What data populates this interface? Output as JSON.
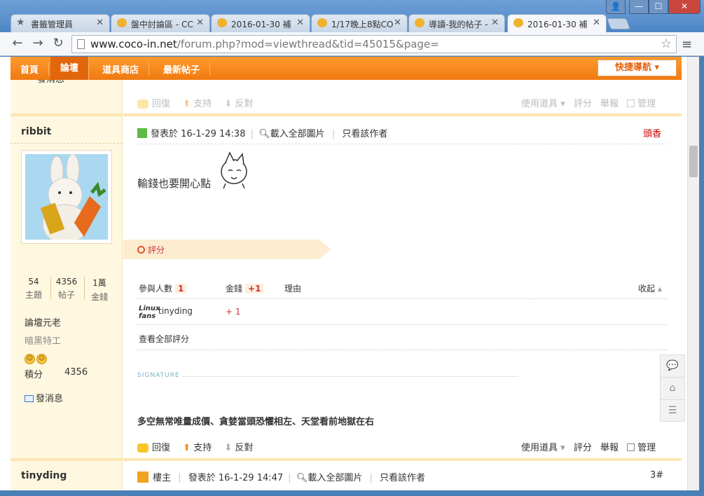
{
  "browser": {
    "tabs": [
      {
        "label": "書籤管理員",
        "icon": "star-icon"
      },
      {
        "label": "盤中討論區 - CC",
        "icon": "coco-icon"
      },
      {
        "label": "2016-01-30 補",
        "icon": "coco-icon"
      },
      {
        "label": "1/17晚上8點CO",
        "icon": "coco-icon"
      },
      {
        "label": "導讀-我的帖子 -",
        "icon": "coco-icon"
      },
      {
        "label": "2016-01-30 補",
        "icon": "coco-icon",
        "active": true
      }
    ],
    "url_host": "www.coco-in.net",
    "url_path": "/forum.php?mod=viewthread&tid=45015&page=",
    "window_buttons": {
      "user": "👤",
      "minimize": "—",
      "maximize": "☐",
      "close": "✕"
    },
    "nav": {
      "back": "←",
      "forward": "→",
      "reload": "↻",
      "menu": "≡",
      "bookmark": "☆"
    }
  },
  "site_nav": {
    "items": [
      "首頁",
      "論壇",
      "道具商店",
      "最新帖子"
    ],
    "quick_nav": "快捷導航 ▾"
  },
  "top_strip": {
    "send_msg_partial": "發消息"
  },
  "prev_actions": {
    "reply": "回復",
    "support": "支持",
    "oppose": "反對",
    "use_item": "使用道具",
    "rate": "評分",
    "report": "舉報",
    "manage": "管理"
  },
  "user1": {
    "name": "ribbit",
    "stats": [
      {
        "value": "54",
        "label": "主題"
      },
      {
        "value": "4356",
        "label": "帖子"
      },
      {
        "value": "1萬",
        "label": "金錢"
      }
    ],
    "rank": "論壇元老",
    "special": "暗黑特工",
    "medals": [
      "☺",
      "☺"
    ],
    "points_label": "積分",
    "points_value": "4356",
    "send_msg": "發消息"
  },
  "post": {
    "posted_at": "發表於 16-1-29 14:38",
    "load_images": "載入全部圖片",
    "author_only": "只看該作者",
    "floor": "頭香",
    "body": "輸錢也要開心點",
    "rate_title": "評分",
    "rate_table": {
      "headers": {
        "participants": "參與人數",
        "participants_count": "1",
        "money": "金錢",
        "money_total": "+1",
        "reason": "理由",
        "collapse": "收起"
      },
      "rows": [
        {
          "avatar_text": "Linux fans",
          "user": "tinyding",
          "money": "+ 1"
        }
      ],
      "view_all": "查看全部評分"
    },
    "signature_label": "SIGNATURE",
    "signature": "多空無常唯量成價、貪婪當頭恐懼相左、天堂看前地獄在右",
    "actions": {
      "reply": "回復",
      "support": "支持",
      "oppose": "反對",
      "use_item": "使用道具",
      "rate": "評分",
      "report": "舉報",
      "manage": "管理"
    }
  },
  "user2": {
    "name": "tinyding",
    "role": "樓主",
    "posted_at": "發表於 16-1-29 14:47",
    "load_images": "載入全部圖片",
    "author_only": "只看該作者",
    "floor": "3#"
  },
  "float_tools": {
    "comment": "💬",
    "top": "⌂",
    "list": "☰"
  }
}
